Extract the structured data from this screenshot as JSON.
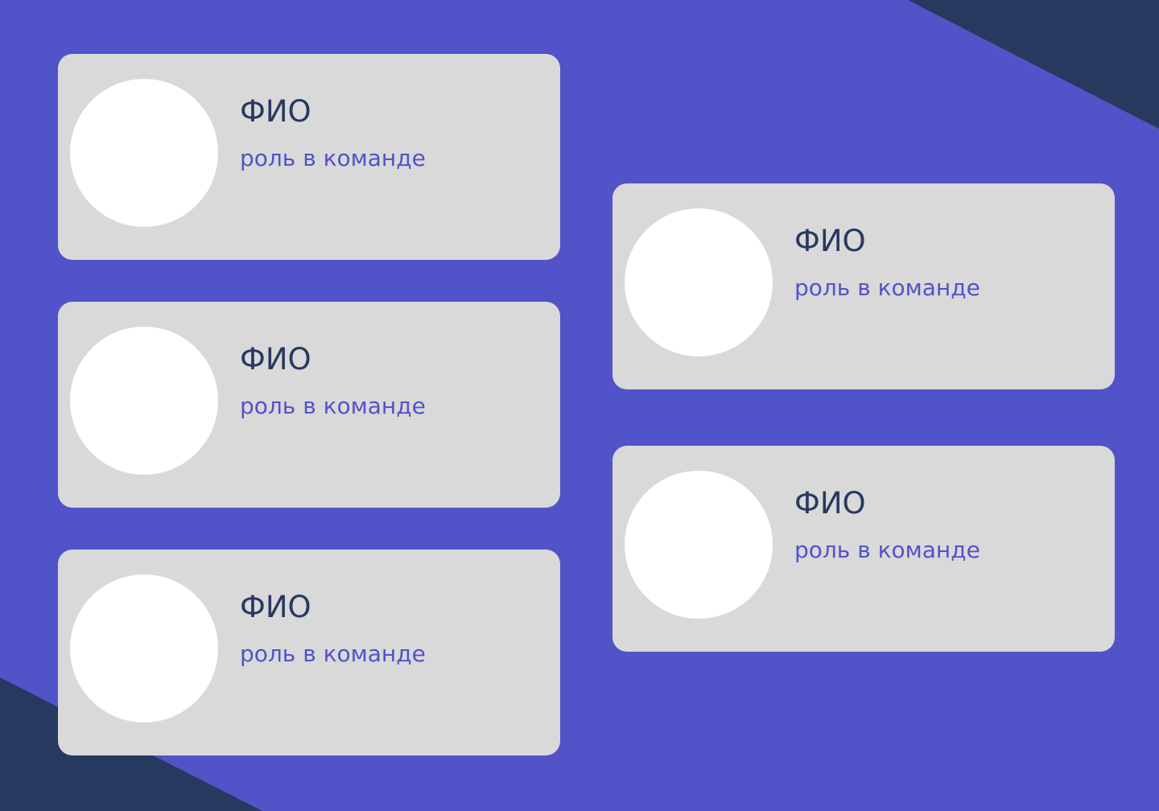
{
  "colors": {
    "background": "#5253c8",
    "corner_accent": "#28395f",
    "card": "#d9d9d9",
    "avatar": "#ffffff",
    "name_text": "#28395f",
    "role_text": "#5253c8"
  },
  "team": {
    "members": [
      {
        "name": "ФИО",
        "role": "роль в команде"
      },
      {
        "name": "ФИО",
        "role": "роль в команде"
      },
      {
        "name": "ФИО",
        "role": "роль в команде"
      },
      {
        "name": "ФИО",
        "role": "роль в команде"
      },
      {
        "name": "ФИО",
        "role": "роль в команде"
      }
    ]
  }
}
